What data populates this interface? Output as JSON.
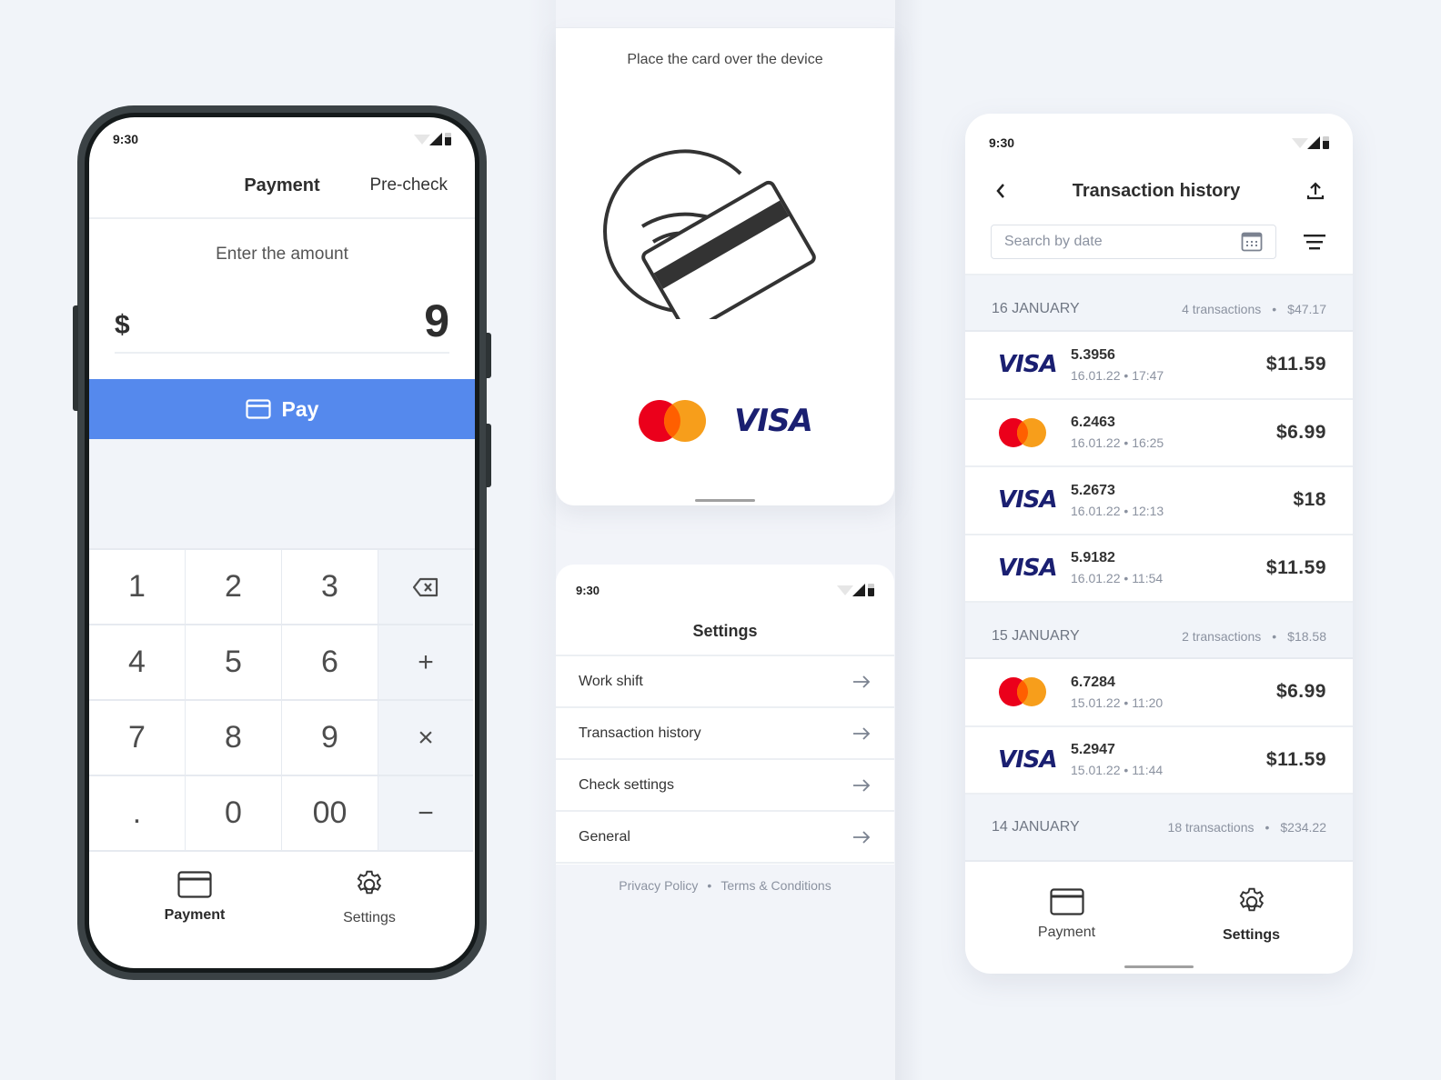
{
  "colors": {
    "accent": "#5589ed",
    "background": "#f1f4f9",
    "visa_blue": "#1a1f71",
    "mastercard_red": "#eb001b",
    "mastercard_orange": "#f79e1b"
  },
  "payment_screen": {
    "status_time": "9:30",
    "title": "Payment",
    "pre_check_label": "Pre-check",
    "enter_label": "Enter the amount",
    "currency_symbol": "$",
    "amount_value": "9",
    "pay_button_label": "Pay",
    "keypad": [
      {
        "label": "1",
        "type": "digit"
      },
      {
        "label": "2",
        "type": "digit"
      },
      {
        "label": "3",
        "type": "digit"
      },
      {
        "label": "backspace",
        "type": "op"
      },
      {
        "label": "4",
        "type": "digit"
      },
      {
        "label": "5",
        "type": "digit"
      },
      {
        "label": "6",
        "type": "digit"
      },
      {
        "label": "+",
        "type": "op"
      },
      {
        "label": "7",
        "type": "digit"
      },
      {
        "label": "8",
        "type": "digit"
      },
      {
        "label": "9",
        "type": "digit"
      },
      {
        "label": "×",
        "type": "op"
      },
      {
        "label": ".",
        "type": "digit"
      },
      {
        "label": "0",
        "type": "digit"
      },
      {
        "label": "00",
        "type": "digit"
      },
      {
        "label": "−",
        "type": "op"
      }
    ],
    "nav": {
      "payment_label": "Payment",
      "settings_label": "Settings",
      "active": "payment"
    }
  },
  "nfc_screen": {
    "caption": "Place the card over the device",
    "visa_label": "VISA"
  },
  "settings_screen": {
    "status_time": "9:30",
    "title": "Settings",
    "items": [
      {
        "label": "Work shift"
      },
      {
        "label": "Transaction history"
      },
      {
        "label": "Check settings"
      },
      {
        "label": "General"
      }
    ],
    "footer": {
      "privacy_label": "Privacy Policy",
      "separator": "•",
      "terms_label": "Terms & Conditions"
    }
  },
  "history_screen": {
    "status_time": "9:30",
    "title": "Transaction history",
    "search_placeholder": "Search by date",
    "groups": [
      {
        "date": "16 JANUARY",
        "count": "4 transactions",
        "total": "$47.17",
        "transactions": [
          {
            "brand": "visa",
            "id": "5.3956",
            "date": "16.01.22",
            "time": "17:47",
            "amount": "$11.59"
          },
          {
            "brand": "mastercard",
            "id": "6.2463",
            "date": "16.01.22",
            "time": "16:25",
            "amount": "$6.99"
          },
          {
            "brand": "visa",
            "id": "5.2673",
            "date": "16.01.22",
            "time": "12:13",
            "amount": "$18"
          },
          {
            "brand": "visa",
            "id": "5.9182",
            "date": "16.01.22",
            "time": "11:54",
            "amount": "$11.59"
          }
        ]
      },
      {
        "date": "15 JANUARY",
        "count": "2 transactions",
        "total": "$18.58",
        "transactions": [
          {
            "brand": "mastercard",
            "id": "6.7284",
            "date": "15.01.22",
            "time": "11:20",
            "amount": "$6.99"
          },
          {
            "brand": "visa",
            "id": "5.2947",
            "date": "15.01.22",
            "time": "11:44",
            "amount": "$11.59"
          }
        ]
      },
      {
        "date": "14 JANUARY",
        "count": "18 transactions",
        "total": "$234.22",
        "transactions": []
      }
    ],
    "nav": {
      "payment_label": "Payment",
      "settings_label": "Settings",
      "active": "settings"
    }
  }
}
